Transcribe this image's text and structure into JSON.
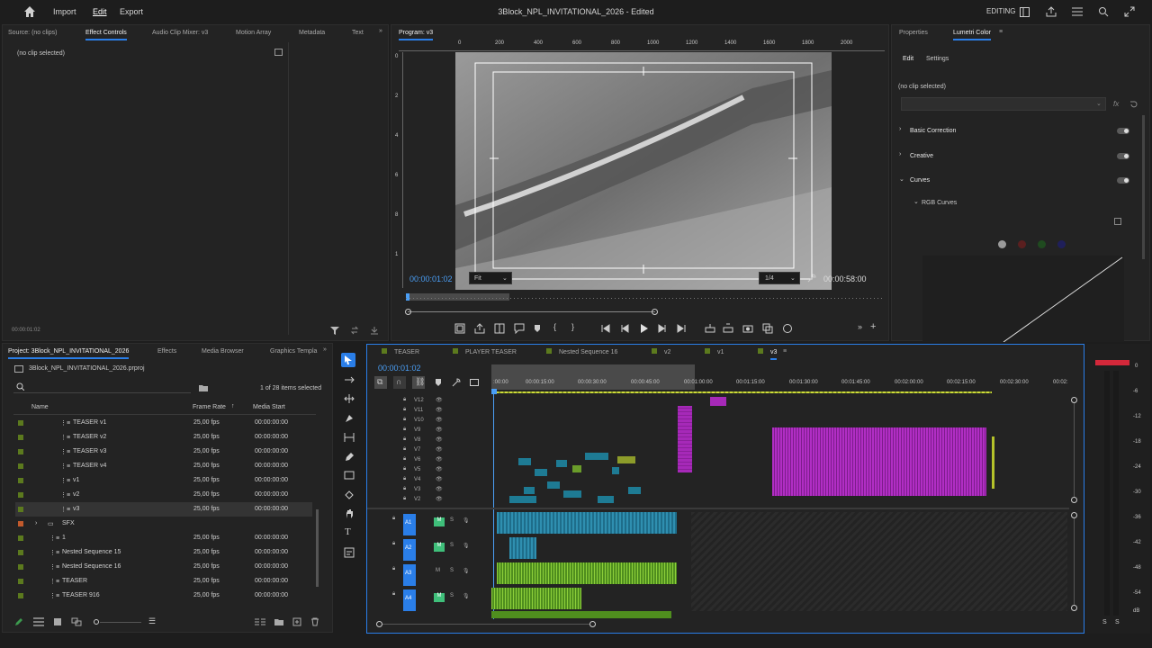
{
  "menu": {
    "import": "Import",
    "edit": "Edit",
    "export": "Export"
  },
  "doc_title": "3Block_NPL_INVITATIONAL_2026 - Edited",
  "workspace": "EDITING",
  "source_panel": {
    "tabs": [
      "Source: (no clips)",
      "Effect Controls",
      "Audio Clip Mixer: v3",
      "Motion Array",
      "Metadata",
      "Text"
    ],
    "no_clip": "(no clip selected)",
    "timecode": "00:00:01:02"
  },
  "program": {
    "tab": "Program: v3",
    "ruler": [
      "0",
      "200",
      "400",
      "600",
      "800",
      "1000",
      "1200",
      "1400",
      "1600",
      "1800",
      "2000"
    ],
    "vruler": [
      "0",
      "2",
      "4",
      "6",
      "8",
      "1"
    ],
    "timecode": "00:00:01:02",
    "fit": "Fit",
    "quality": "1/4",
    "duration": "00:00:58:00"
  },
  "lumetri": {
    "tabs": [
      "Properties",
      "Lumetri Color"
    ],
    "subtabs": [
      "Edit",
      "Settings"
    ],
    "no_clip": "(no clip selected)",
    "sections": [
      "Basic Correction",
      "Creative",
      "Curves"
    ],
    "rgb_curves": "RGB Curves",
    "fx": "fx"
  },
  "project": {
    "tabs": [
      "Project: 3Block_NPL_INVITATIONAL_2026",
      "Effects",
      "Media Browser",
      "Graphics Templa"
    ],
    "file": "3Block_NPL_INVITATIONAL_2026.prproj",
    "count": "1 of 28 items selected",
    "columns": [
      "Name",
      "Frame Rate",
      "Media Start"
    ],
    "items": [
      {
        "name": "TEASER v1",
        "rate": "25,00 fps",
        "start": "00:00:00:00",
        "color": "#5c7a1e"
      },
      {
        "name": "TEASER v2",
        "rate": "25,00 fps",
        "start": "00:00:00:00",
        "color": "#5c7a1e"
      },
      {
        "name": "TEASER v3",
        "rate": "25,00 fps",
        "start": "00:00:00:00",
        "color": "#5c7a1e"
      },
      {
        "name": "TEASER v4",
        "rate": "25,00 fps",
        "start": "00:00:00:00",
        "color": "#5c7a1e"
      },
      {
        "name": "v1",
        "rate": "25,00 fps",
        "start": "00:00:00:00",
        "color": "#5c7a1e"
      },
      {
        "name": "v2",
        "rate": "25,00 fps",
        "start": "00:00:00:00",
        "color": "#5c7a1e"
      },
      {
        "name": "v3",
        "rate": "25,00 fps",
        "start": "00:00:00:00",
        "color": "#5c7a1e"
      },
      {
        "name": "SFX",
        "rate": "",
        "start": "",
        "color": "#c25a2c"
      },
      {
        "name": "1",
        "rate": "25,00 fps",
        "start": "00:00:00:00",
        "color": "#5c7a1e"
      },
      {
        "name": "Nested Sequence 15",
        "rate": "25,00 fps",
        "start": "00:00:00:00",
        "color": "#5c7a1e"
      },
      {
        "name": "Nested Sequence 16",
        "rate": "25,00 fps",
        "start": "00:00:00:00",
        "color": "#5c7a1e"
      },
      {
        "name": "TEASER",
        "rate": "25,00 fps",
        "start": "00:00:00:00",
        "color": "#5c7a1e"
      },
      {
        "name": "TEASER 916",
        "rate": "25,00 fps",
        "start": "00:00:00:00",
        "color": "#5c7a1e"
      }
    ]
  },
  "timeline": {
    "tabs": [
      "TEASER",
      "PLAYER TEASER",
      "Nested Sequence 16",
      "v2",
      "v1",
      "v3"
    ],
    "timecode": "00:00:01:02",
    "ruler": [
      ":00:00",
      "00:00:15:00",
      "00:00:30:00",
      "00:00:45:00",
      "00:01:00:00",
      "00:01:15:00",
      "00:01:30:00",
      "00:01:45:00",
      "00:02:00:00",
      "00:02:15:00",
      "00:02:30:00",
      "00:02:"
    ],
    "video_tracks": [
      "V12",
      "V11",
      "V10",
      "V9",
      "V8",
      "V7",
      "V6",
      "V5",
      "V4",
      "V3",
      "V2"
    ],
    "audio_tracks": [
      "A1",
      "A2",
      "A3",
      "A4"
    ]
  },
  "meter": {
    "scale": [
      "0",
      "-6",
      "-12",
      "-18",
      "-24",
      "-30",
      "-36",
      "-42",
      "-48",
      "-54",
      "dB"
    ],
    "solo": [
      "S",
      "S"
    ]
  },
  "colors": {
    "accent": "#2a7ee8",
    "purple": "#9c27b0",
    "teal": "#1e7b94",
    "green": "#6a9c2a"
  }
}
